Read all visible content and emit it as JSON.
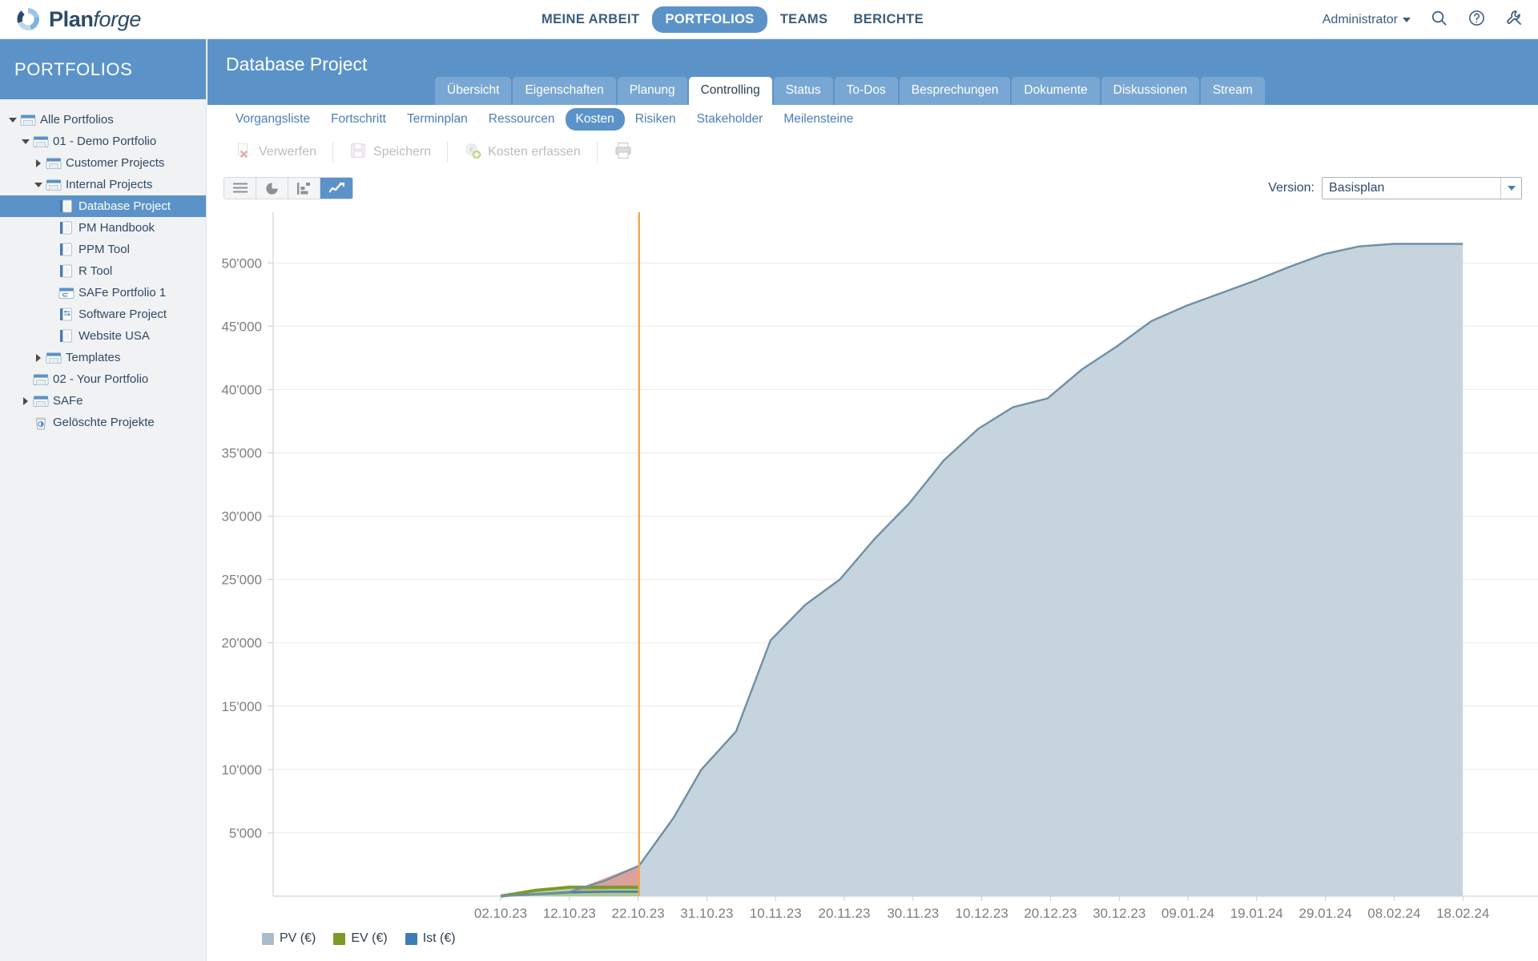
{
  "brand": {
    "name_bold": "Plan",
    "name_light": "forge",
    "logo_icon": "planforge-logo-icon"
  },
  "topnav": {
    "items": [
      {
        "label": "MEINE ARBEIT",
        "active": false
      },
      {
        "label": "PORTFOLIOS",
        "active": true
      },
      {
        "label": "TEAMS",
        "active": false
      },
      {
        "label": "BERICHTE",
        "active": false
      }
    ],
    "user": "Administrator",
    "icons": [
      "search-icon",
      "help-icon",
      "tools-icon"
    ]
  },
  "sidebar": {
    "header": "PORTFOLIOS",
    "items": [
      {
        "label": "Alle Portfolios",
        "depth": 0,
        "twisty": "down",
        "icon": "portfolio-folder-icon",
        "selected": false
      },
      {
        "label": "01 - Demo Portfolio",
        "depth": 1,
        "twisty": "down",
        "icon": "portfolio-folder-icon",
        "selected": false
      },
      {
        "label": "Customer Projects",
        "depth": 2,
        "twisty": "right",
        "icon": "portfolio-folder-icon",
        "selected": false
      },
      {
        "label": "Internal Projects",
        "depth": 2,
        "twisty": "down",
        "icon": "portfolio-folder-icon",
        "selected": false
      },
      {
        "label": "Database Project",
        "depth": 3,
        "twisty": "none",
        "icon": "project-icon",
        "selected": true
      },
      {
        "label": "PM Handbook",
        "depth": 3,
        "twisty": "none",
        "icon": "project-icon",
        "selected": false
      },
      {
        "label": "PPM Tool",
        "depth": 3,
        "twisty": "none",
        "icon": "project-icon",
        "selected": false
      },
      {
        "label": "R Tool",
        "depth": 3,
        "twisty": "none",
        "icon": "project-icon",
        "selected": false
      },
      {
        "label": "SAFe Portfolio 1",
        "depth": 3,
        "twisty": "none",
        "icon": "safe-portfolio-icon",
        "selected": false
      },
      {
        "label": "Software Project",
        "depth": 3,
        "twisty": "none",
        "icon": "agile-project-icon",
        "selected": false
      },
      {
        "label": "Website USA",
        "depth": 3,
        "twisty": "none",
        "icon": "project-icon",
        "selected": false
      },
      {
        "label": "Templates",
        "depth": 2,
        "twisty": "right",
        "icon": "portfolio-folder-icon",
        "selected": false
      },
      {
        "label": "02 - Your Portfolio",
        "depth": 1,
        "twisty": "none",
        "icon": "portfolio-folder-icon",
        "selected": false
      },
      {
        "label": "SAFe",
        "depth": 1,
        "twisty": "right",
        "icon": "portfolio-folder-icon",
        "selected": false
      },
      {
        "label": "Gelöschte Projekte",
        "depth": 1,
        "twisty": "none",
        "icon": "trash-icon",
        "selected": false
      }
    ]
  },
  "page": {
    "title": "Database Project",
    "tabs": [
      {
        "label": "Übersicht",
        "active": false
      },
      {
        "label": "Eigenschaften",
        "active": false
      },
      {
        "label": "Planung",
        "active": false
      },
      {
        "label": "Controlling",
        "active": true
      },
      {
        "label": "Status",
        "active": false
      },
      {
        "label": "To-Dos",
        "active": false
      },
      {
        "label": "Besprechungen",
        "active": false
      },
      {
        "label": "Dokumente",
        "active": false
      },
      {
        "label": "Diskussionen",
        "active": false
      },
      {
        "label": "Stream",
        "active": false
      }
    ],
    "subtabs": [
      {
        "label": "Vorgangsliste",
        "active": false
      },
      {
        "label": "Fortschritt",
        "active": false
      },
      {
        "label": "Terminplan",
        "active": false
      },
      {
        "label": "Ressourcen",
        "active": false
      },
      {
        "label": "Kosten",
        "active": true
      },
      {
        "label": "Risiken",
        "active": false
      },
      {
        "label": "Stakeholder",
        "active": false
      },
      {
        "label": "Meilensteine",
        "active": false
      }
    ]
  },
  "toolbar": {
    "discard_label": "Verwerfen",
    "save_label": "Speichern",
    "record_costs_label": "Kosten erfassen",
    "print_icon": "printer-icon",
    "discard_icon": "discard-x-icon",
    "save_icon": "floppy-disk-icon",
    "record_costs_icon": "euro-add-icon"
  },
  "viewbar": {
    "buttons": [
      {
        "icon": "list-view-icon",
        "active": false
      },
      {
        "icon": "pie-chart-icon",
        "active": false
      },
      {
        "icon": "bar-chart-icon",
        "active": false
      },
      {
        "icon": "line-chart-icon",
        "active": true
      }
    ],
    "version_label": "Version:",
    "version_value": "Basisplan",
    "version_arrow_icon": "chevron-down-icon"
  },
  "colors": {
    "brand_blue": "#5b93c9",
    "nav_text": "#3b5c7e",
    "pv_fill": "#c3d2dc",
    "pv_stroke": "#6f8fa6",
    "ev_fill": "#9dbb4e",
    "ev_stroke": "#7a9a2e",
    "ist_fill": "#3f7cb5",
    "variance_red": "#e09a94",
    "today_line": "#f0aa4e",
    "grid": "#e8eaec",
    "axis_text": "#7b7f84"
  },
  "chart_data": {
    "type": "area",
    "title": "",
    "xlabel": "",
    "ylabel": "",
    "ylim": [
      0,
      54000
    ],
    "yticks": [
      5000,
      10000,
      15000,
      20000,
      25000,
      30000,
      35000,
      40000,
      45000,
      50000
    ],
    "ytick_labels": [
      "5'000",
      "10'000",
      "15'000",
      "20'000",
      "25'000",
      "30'000",
      "35'000",
      "40'000",
      "45'000",
      "50'000"
    ],
    "grid": true,
    "legend_position": "bottom-left",
    "xticks": [
      "02.10.23",
      "12.10.23",
      "22.10.23",
      "31.10.23",
      "10.11.23",
      "20.11.23",
      "30.11.23",
      "10.12.23",
      "20.12.23",
      "30.12.23",
      "09.01.24",
      "19.01.24",
      "29.01.24",
      "08.02.24",
      "18.02.24"
    ],
    "today_marker": {
      "label": "",
      "x_index_fraction": 0.115
    },
    "series": [
      {
        "name": "PV (€)",
        "color": "#c3d2dc",
        "stroke": "#6f8fa6",
        "x": [
          "02.10.23",
          "12.10.23",
          "17.10.23",
          "22.10.23",
          "27.10.23",
          "31.10.23",
          "05.11.23",
          "10.11.23",
          "15.11.23",
          "20.11.23",
          "25.11.23",
          "30.11.23",
          "05.12.23",
          "10.12.23",
          "15.12.23",
          "20.12.23",
          "25.12.23",
          "30.12.23",
          "04.01.24",
          "09.01.24",
          "14.01.24",
          "19.01.24",
          "24.01.24",
          "29.01.24",
          "03.02.24",
          "08.02.24",
          "13.02.24",
          "18.02.24"
        ],
        "values": [
          0,
          350,
          1200,
          2400,
          6200,
          10000,
          13000,
          20200,
          23000,
          25000,
          28200,
          31000,
          34400,
          36900,
          38600,
          39300,
          41600,
          43400,
          45400,
          46600,
          47600,
          48600,
          49700,
          50700,
          51300,
          51500,
          51500,
          51500
        ]
      },
      {
        "name": "EV (€)",
        "color": "#9dbb4e",
        "stroke": "#7a9a2e",
        "x": [
          "02.10.23",
          "07.10.23",
          "12.10.23",
          "17.10.23",
          "22.10.23"
        ],
        "values": [
          0,
          450,
          700,
          700,
          700
        ]
      },
      {
        "name": "Ist (€)",
        "color": "#3f7cb5",
        "stroke": "#2e66a0",
        "x": [
          "02.10.23",
          "07.10.23",
          "12.10.23",
          "17.10.23",
          "22.10.23"
        ],
        "values": [
          0,
          150,
          300,
          350,
          350
        ]
      }
    ]
  },
  "legend": [
    {
      "label": "PV (€)",
      "color": "#a9bccb"
    },
    {
      "label": "EV (€)",
      "color": "#7d9a29"
    },
    {
      "label": "Ist (€)",
      "color": "#3f7cb5"
    }
  ]
}
